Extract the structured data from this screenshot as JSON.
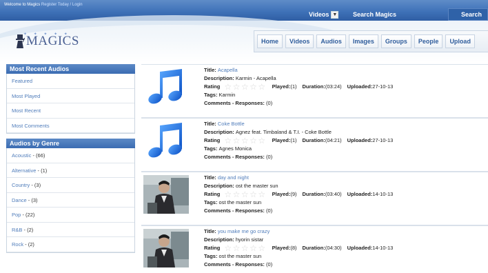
{
  "header": {
    "welcome": "Welcome to Magics",
    "register": "Register Today",
    "slash": "/",
    "login": "Login",
    "search_select": "Videos",
    "search_placeholder": "Search Magics",
    "search_button": "Search",
    "logo_text": "MAGICS",
    "nav": [
      "Home",
      "Videos",
      "Audios",
      "Images",
      "Groups",
      "People",
      "Upload"
    ]
  },
  "sidebar": {
    "recent_title": "Most Recent Audios",
    "recent_items": [
      "Featured",
      "Most Played",
      "Most Recent",
      "Most Comments"
    ],
    "genre_title": "Audios by Genre",
    "genres": [
      {
        "name": "Acoustic",
        "count": " - (66)"
      },
      {
        "name": "Alternative",
        "count": " - (1)"
      },
      {
        "name": "Country",
        "count": " - (3)"
      },
      {
        "name": "Dance",
        "count": " - (3)"
      },
      {
        "name": "Pop",
        "count": " - (22)"
      },
      {
        "name": "R&B",
        "count": " - (2)"
      },
      {
        "name": "Rock",
        "count": " - (2)"
      }
    ]
  },
  "labels": {
    "title": "Title: ",
    "description": "Description: ",
    "rating": "Rating",
    "played": "Played:",
    "duration": "Duration:",
    "uploaded": "Uploaded:",
    "tags": "Tags: ",
    "comments": "Comments - Responses:",
    "stars": "☆☆☆☆☆"
  },
  "audios": [
    {
      "thumb": "music-note",
      "title": "Acapella",
      "description": "Karmin - Acapella",
      "played": " (1)",
      "duration": " (03:24)",
      "uploaded": " 27-10-13",
      "tags": "Karmin",
      "responses": " (0)"
    },
    {
      "thumb": "music-note",
      "title": "Coke Bottle",
      "description": "Agnez feat. Timbaland & T.I. - Coke Bottle",
      "played": " (1)",
      "duration": " (04:21)",
      "uploaded": " 27-10-13",
      "tags": "Agnes Monica",
      "responses": " (0)"
    },
    {
      "thumb": "photo",
      "title": "day and night",
      "description": "ost the master sun",
      "played": " (9)",
      "duration": " (03:40)",
      "uploaded": " 14-10-13",
      "tags": "ost the master sun",
      "responses": " (0)"
    },
    {
      "thumb": "photo",
      "title": "you make me go crazy",
      "description": "hyorin sistar",
      "played": " (8)",
      "duration": " (04:30)",
      "uploaded": " 14-10-13",
      "tags": "ost the master sun",
      "responses": " (0)"
    }
  ]
}
